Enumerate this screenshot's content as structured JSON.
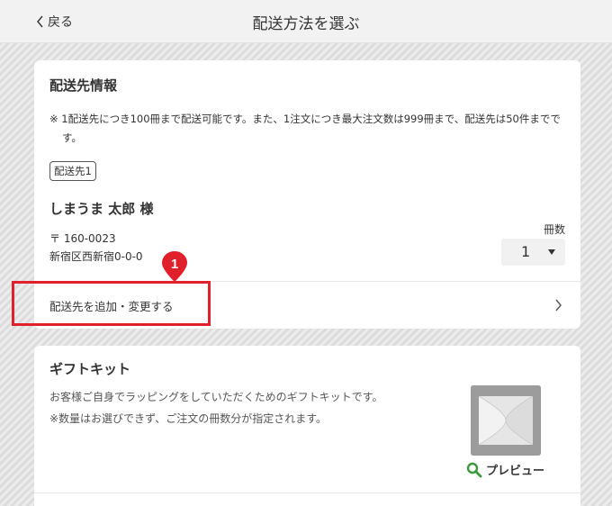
{
  "header": {
    "back_label": "戻る",
    "title": "配送方法を選ぶ"
  },
  "delivery": {
    "title": "配送先情報",
    "note": "※ 1配送先につき100冊まで配送可能です。また、1注文につき最大注文数は999冊まで、配送先は50件までです。",
    "tag": "配送先1",
    "recipient": "しまうま 太郎 様",
    "postal": "〒 160-0023",
    "address": "新宿区西新宿0-0-0",
    "quantity_label": "冊数",
    "quantity_value": "1",
    "add_change_label": "配送先を追加・変更する"
  },
  "annotation": {
    "step_number": "1",
    "highlight_color": "#e0212b"
  },
  "gift": {
    "title": "ギフトキット",
    "desc1": "お客様ご自身でラッピングをしていただくためのギフトキットです。",
    "desc2": "※数量はお選びできず、ご注文の冊数分が指定されます。",
    "preview_label": "プレビュー"
  },
  "colors": {
    "accent_green": "#3a9a3a",
    "accent_red": "#e0212b"
  },
  "icons": {
    "back": "chevron-left-icon",
    "caret": "caret-down-icon",
    "link": "chevron-right-icon",
    "preview": "magnifier-icon"
  }
}
